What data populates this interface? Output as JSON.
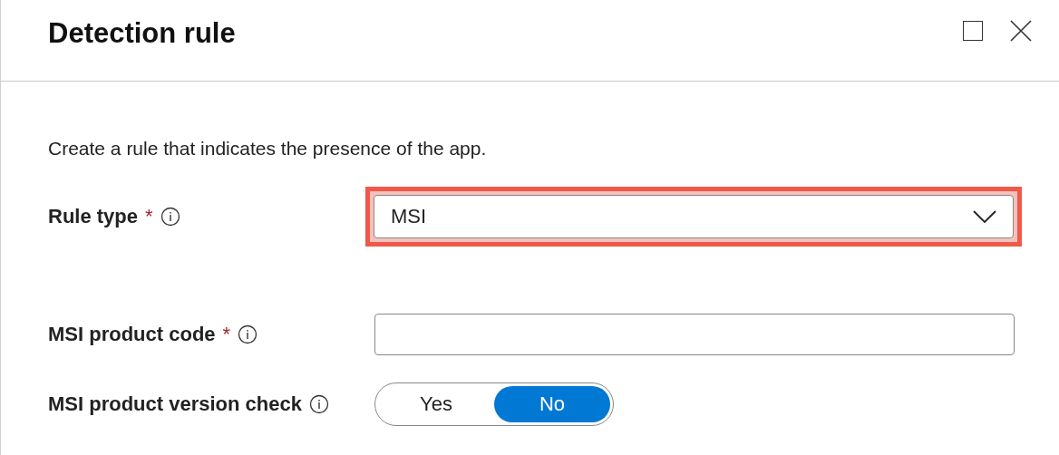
{
  "panel": {
    "title": "Detection rule"
  },
  "description": "Create a rule that indicates the presence of the app.",
  "fields": [
    {
      "kind": "dropdown",
      "label": "Rule type",
      "required_mark": "*",
      "value": "MSI",
      "highlighted": true
    },
    {
      "kind": "text",
      "label": "MSI product code",
      "required_mark": "*"
    },
    {
      "kind": "toggle",
      "label": "MSI product version check",
      "options": [
        {
          "label": "Yes",
          "selected": false
        },
        {
          "label": "No",
          "selected": true
        }
      ]
    }
  ]
}
